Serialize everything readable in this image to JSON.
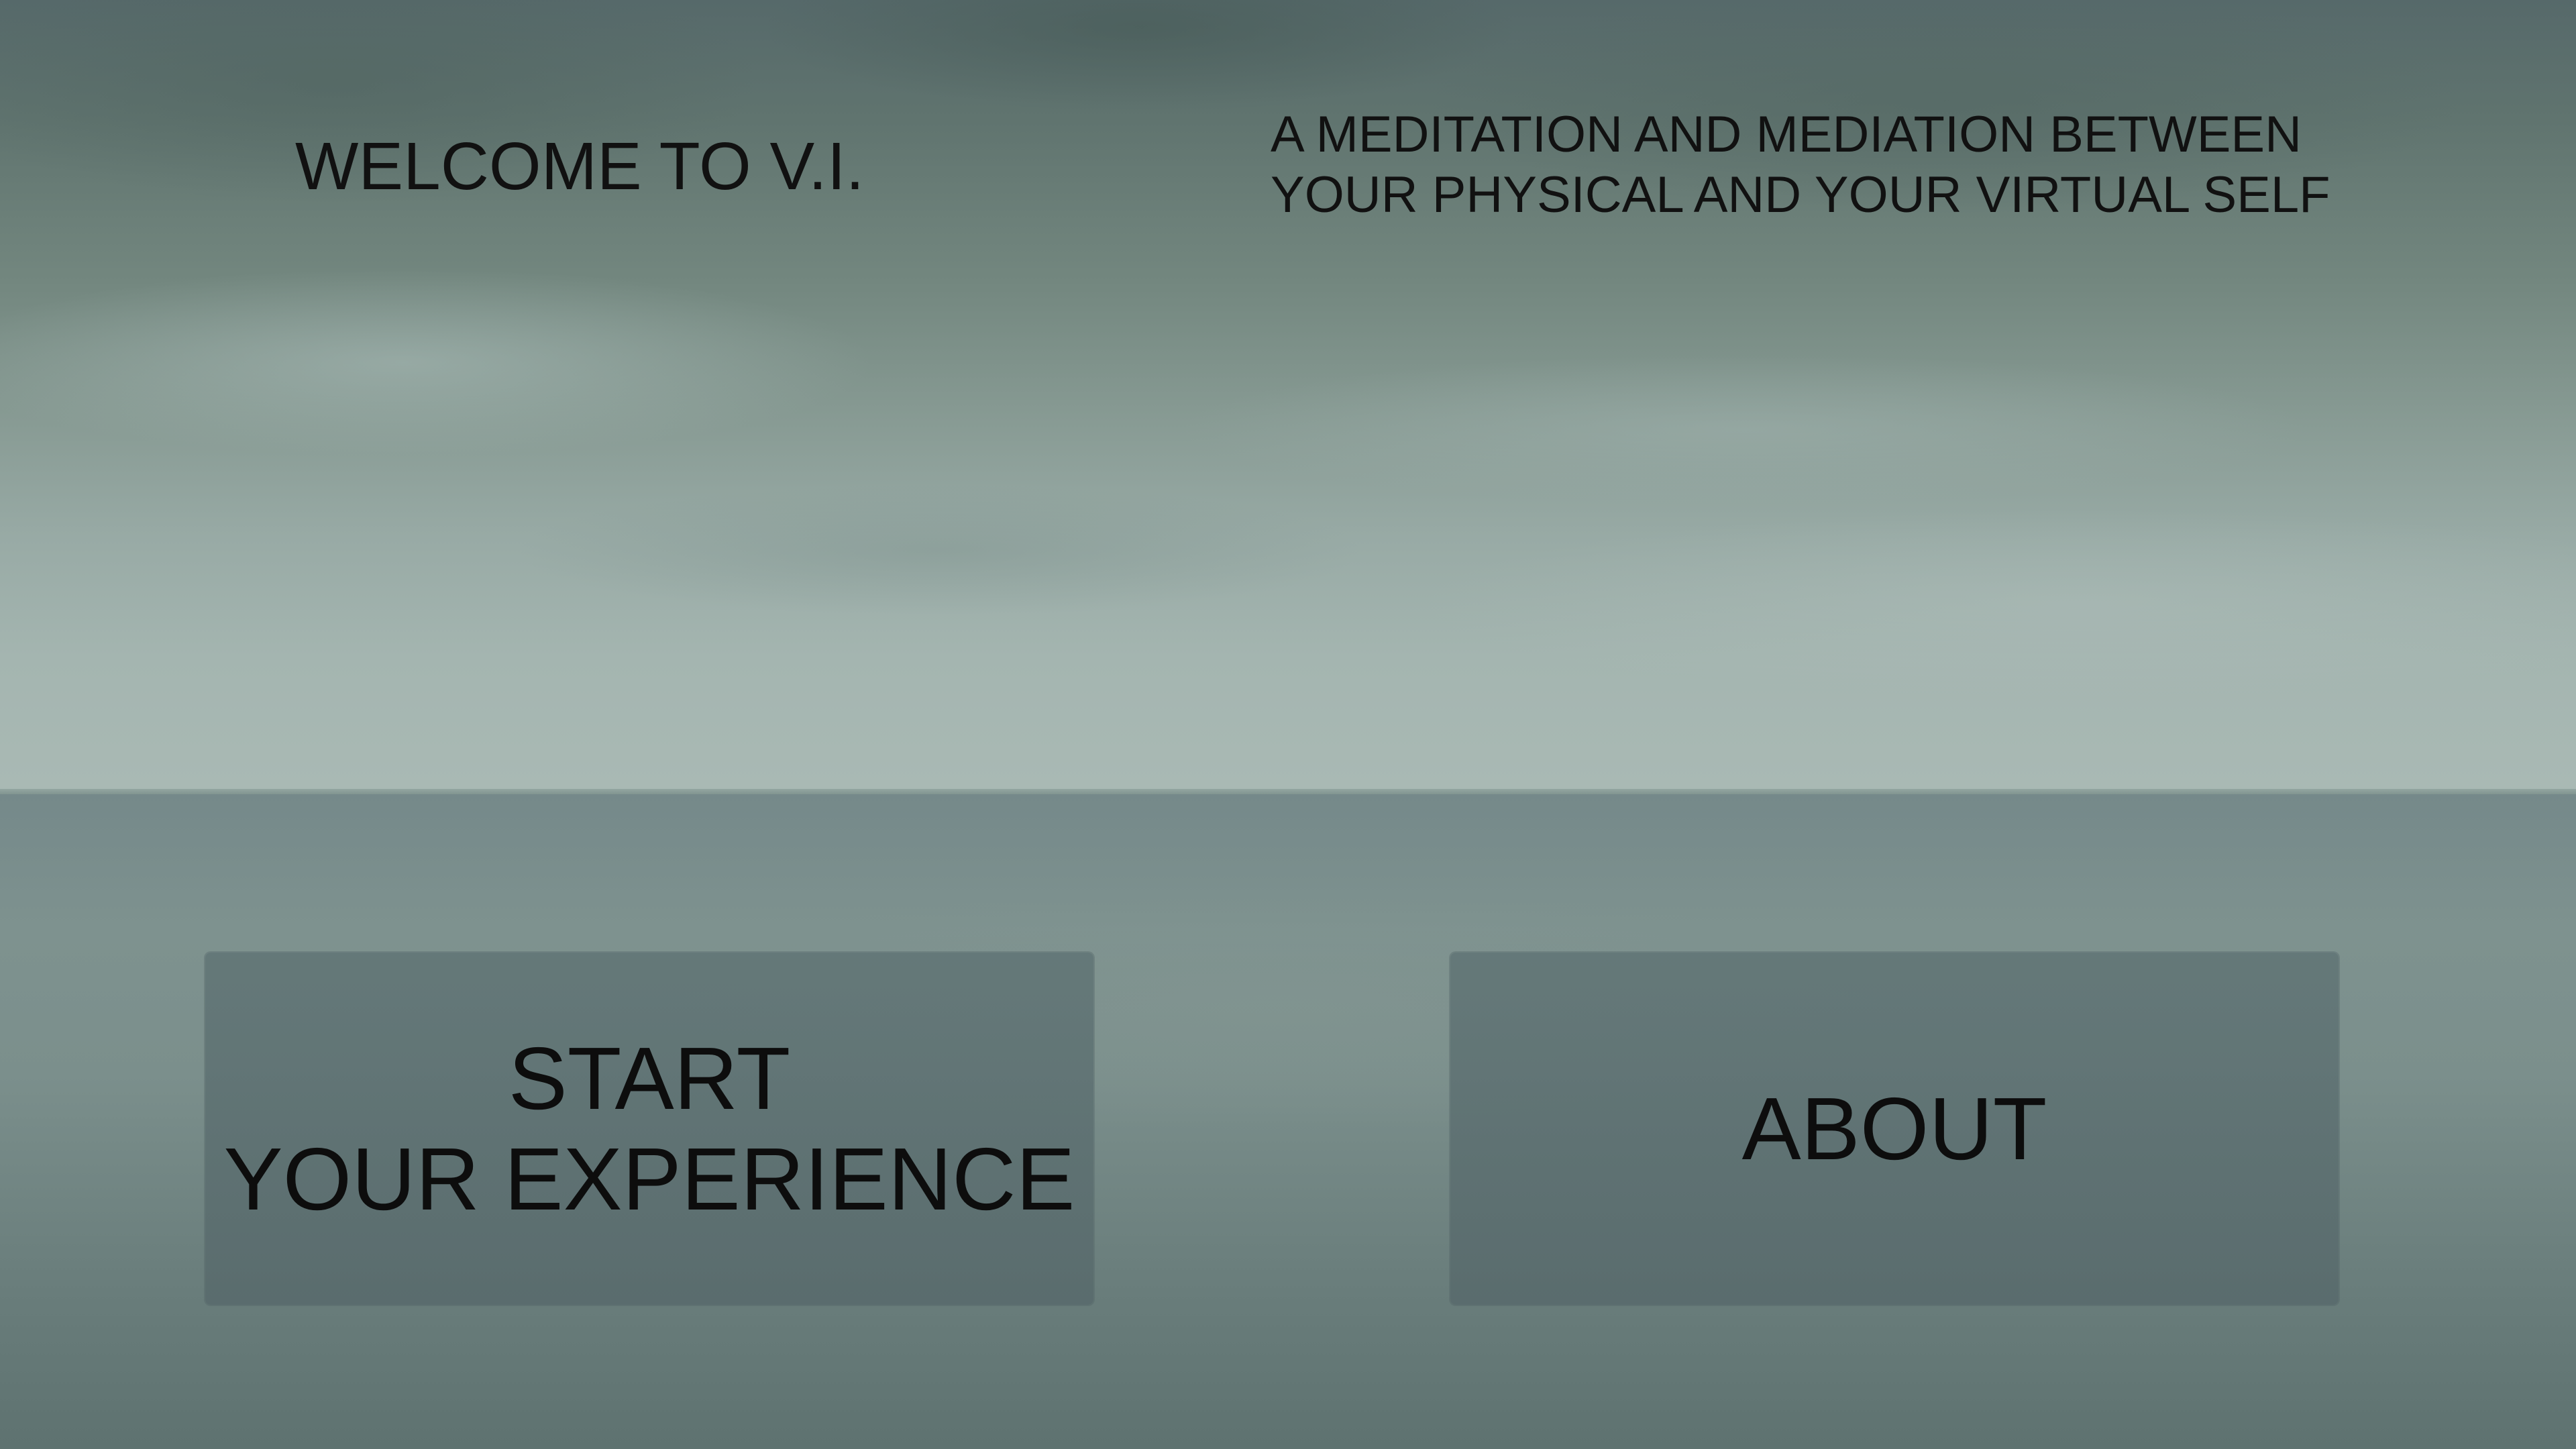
{
  "header": {
    "title": "WELCOME TO V.I.",
    "subtitle_lines": [
      "A MEDITATION AND MEDIATION BETWEEN",
      "YOUR PHYSICAL AND YOUR VIRTUAL SELF"
    ]
  },
  "menu": {
    "start_lines": [
      "START",
      "YOUR EXPERIENCE"
    ],
    "about_label": "ABOUT"
  },
  "background": {
    "scene": "overcast sky over calm sea",
    "sky_color": "#879a93",
    "sea_color": "#6b7f7d"
  }
}
